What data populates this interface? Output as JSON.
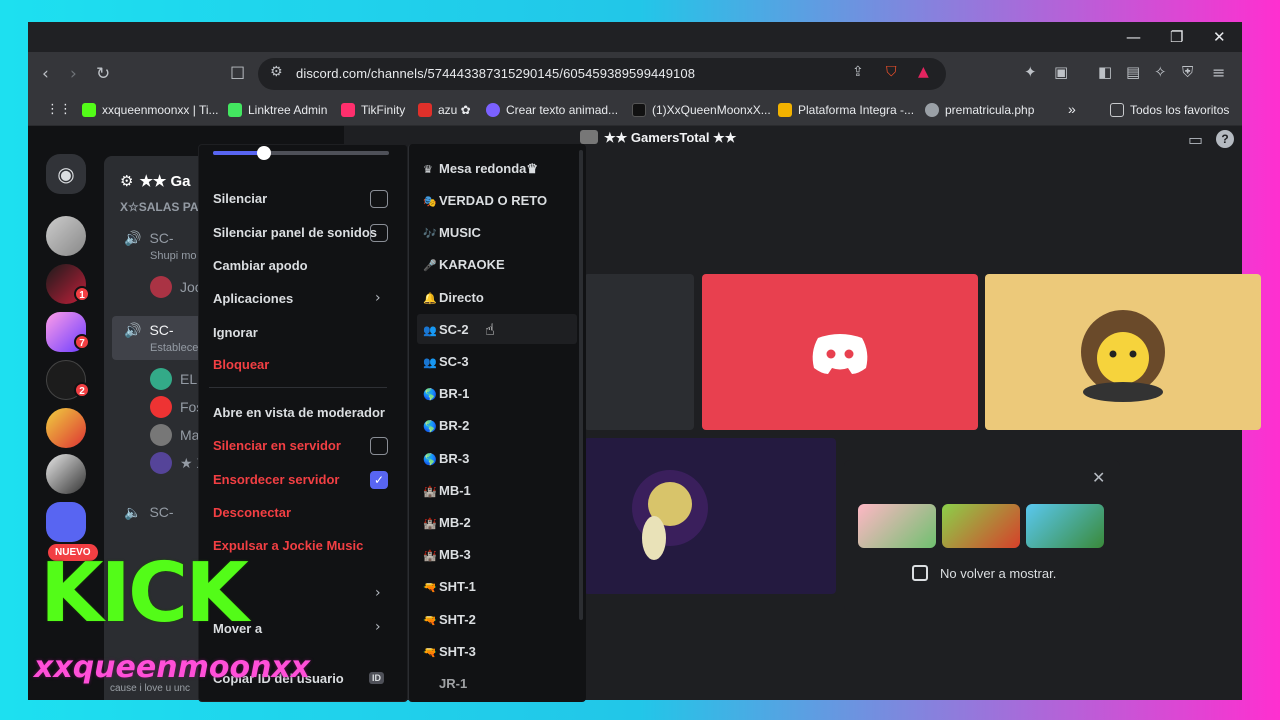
{
  "colors": {
    "neon_cyan": "#1de0f0",
    "neon_pink": "#ff2fd0",
    "discord_blurple": "#5865f2",
    "danger_red": "#f23f43",
    "kick_green": "#53fc18"
  },
  "window": {
    "minimize": "—",
    "restore": "❐",
    "close": "✕"
  },
  "browser": {
    "url": "discord.com/channels/574443387315290145/605459389599449108",
    "bookmarks": [
      {
        "label": "xxqueenmoonxx | Ti...",
        "color": "#53fc18"
      },
      {
        "label": "Linktree Admin",
        "color": "#43e660"
      },
      {
        "label": "TikFinity",
        "color": "#ff2f6d"
      },
      {
        "label": "azu ✿",
        "color": "#e0302a"
      },
      {
        "label": "Crear texto animad...",
        "color": "#7b61ff"
      },
      {
        "label": "(1)XxQueenMoonxX...",
        "color": "#111111"
      },
      {
        "label": "Plataforma Integra -...",
        "color": "#f2b200"
      },
      {
        "label": "prematricula.php",
        "color": "#9aa0a6"
      }
    ],
    "more": "»",
    "all_bookmarks": "Todos los favoritos"
  },
  "server": {
    "name": "★★ GamersTotal ★★",
    "name_short": "★★ Ga"
  },
  "channels": {
    "category": "X☆SALAS PA",
    "items": [
      {
        "label": "SC-",
        "sub": "Shupi mo"
      },
      {
        "label": "Joc"
      },
      {
        "label": "SC-",
        "sub": "Establece"
      },
      {
        "label": "ELL"
      },
      {
        "label": "Fos"
      },
      {
        "label": "Ma"
      },
      {
        "label": "★ X"
      },
      {
        "label": "SC-"
      }
    ]
  },
  "guild_badges": {
    "b1": "1",
    "b2": "7",
    "b3": "2"
  },
  "nuevo": "NUEVO",
  "context_menu": {
    "items": [
      {
        "label": "Silenciar",
        "checkbox": false
      },
      {
        "label": "Silenciar panel de sonidos",
        "checkbox": false
      },
      {
        "label": "Cambiar apodo"
      },
      {
        "label": "Aplicaciones",
        "submenu": true
      },
      {
        "label": "Ignorar"
      },
      {
        "label": "Bloquear",
        "danger": true
      },
      {
        "label": "Abre en vista de moderador"
      },
      {
        "label": "Silenciar en servidor",
        "danger": true,
        "checkbox": false
      },
      {
        "label": "Ensordecer servidor",
        "danger": true,
        "checkbox": true
      },
      {
        "label": "Desconectar",
        "danger": true
      },
      {
        "label": "Expulsar a Jockie Music",
        "danger": true
      },
      {
        "label": "Mover a",
        "submenu": true
      },
      {
        "label": "Copiar ID del usuario",
        "badge": "ID"
      }
    ],
    "volume_percent": 31
  },
  "move_submenu": {
    "items": [
      {
        "icon": "♛",
        "label": "Mesa redonda♛"
      },
      {
        "icon": "🎭",
        "label": "VERDAD O RETO"
      },
      {
        "icon": "🎶",
        "label": "MUSIC"
      },
      {
        "icon": "🎤",
        "label": "KARAOKE"
      },
      {
        "icon": "🔔",
        "label": "Directo"
      },
      {
        "icon": "👥",
        "label": "SC-2"
      },
      {
        "icon": "👥",
        "label": "SC-3"
      },
      {
        "icon": "🌎",
        "label": "BR-1"
      },
      {
        "icon": "🌎",
        "label": "BR-2"
      },
      {
        "icon": "🌎",
        "label": "BR-3"
      },
      {
        "icon": "🏰",
        "label": "MB-1"
      },
      {
        "icon": "🏰",
        "label": "MB-2"
      },
      {
        "icon": "🏰",
        "label": "MB-3"
      },
      {
        "icon": "🔫",
        "label": "SHT-1"
      },
      {
        "icon": "🔫",
        "label": "SHT-2"
      },
      {
        "icon": "🔫",
        "label": "SHT-3"
      },
      {
        "icon": "",
        "label": "JR-1"
      }
    ]
  },
  "promo": {
    "checkbox_label": "No volver a mostrar."
  },
  "overlay": {
    "kick": "KICK",
    "handle": "xxqueenmoonxx",
    "status": "cause i love u unc"
  }
}
